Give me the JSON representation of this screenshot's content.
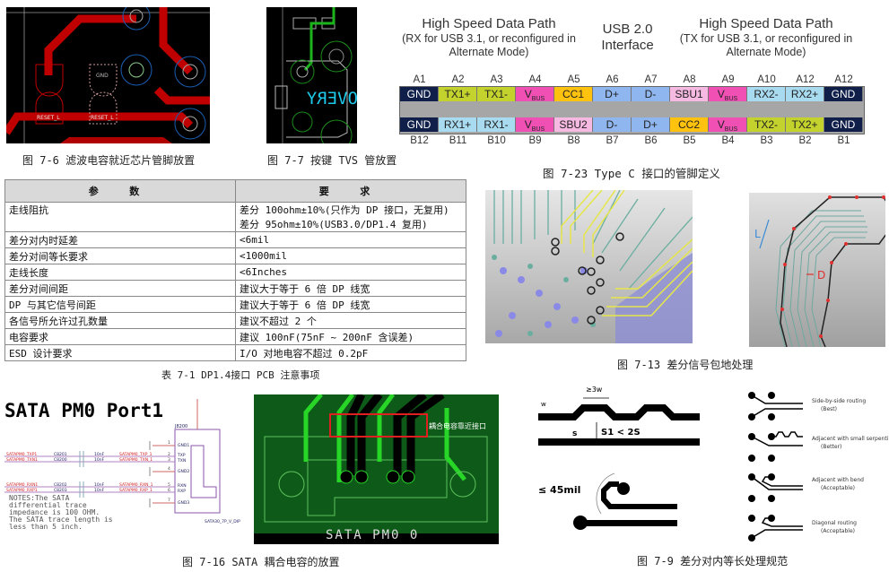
{
  "fig_7_6": {
    "caption": "图 7-6 滤波电容就近芯片管脚放置",
    "pcb_labels": [
      "GND",
      "RESET_L",
      "RESET_L"
    ]
  },
  "fig_7_7": {
    "caption": "图 7-7 按键 TVS 管放置",
    "silkscreen": "OVERY"
  },
  "usb_c": {
    "groups": [
      {
        "title": "High Speed Data Path",
        "sub": "(RX for USB 3.1, or reconfigured in Alternate Mode)",
        "color": "#a9dbf0"
      },
      {
        "title": "USB 2.0 Interface",
        "sub": "",
        "color": "#8fb6ee"
      },
      {
        "title": "High Speed Data Path",
        "sub": "(TX for USB 3.1, or reconfigured in Alternate Mode)",
        "color": "#c3d22c"
      }
    ],
    "row_a_labels": [
      "A1",
      "A2",
      "A3",
      "A4",
      "A5",
      "A6",
      "A7",
      "A8",
      "A9",
      "A10",
      "A12",
      "A12"
    ],
    "row_a_pins": [
      {
        "name": "GND",
        "sub": "",
        "color": "#0f1f4a",
        "text": "#ffffff"
      },
      {
        "name": "TX1+",
        "sub": "",
        "color": "#c3d22c",
        "text": "#222"
      },
      {
        "name": "TX1-",
        "sub": "",
        "color": "#c3d22c",
        "text": "#222"
      },
      {
        "name": "V",
        "sub": "BUS",
        "color": "#f050b4",
        "text": "#222"
      },
      {
        "name": "CC1",
        "sub": "",
        "color": "#ffc20e",
        "text": "#222"
      },
      {
        "name": "D+",
        "sub": "",
        "color": "#8fb6ee",
        "text": "#222"
      },
      {
        "name": "D-",
        "sub": "",
        "color": "#8fb6ee",
        "text": "#222"
      },
      {
        "name": "SBU1",
        "sub": "",
        "color": "#f6b9e2",
        "text": "#222"
      },
      {
        "name": "V",
        "sub": "BUS",
        "color": "#f050b4",
        "text": "#222"
      },
      {
        "name": "RX2-",
        "sub": "",
        "color": "#a9dbf0",
        "text": "#222"
      },
      {
        "name": "RX2+",
        "sub": "",
        "color": "#a9dbf0",
        "text": "#222"
      },
      {
        "name": "GND",
        "sub": "",
        "color": "#0f1f4a",
        "text": "#ffffff"
      }
    ],
    "row_b_pins": [
      {
        "name": "GND",
        "sub": "",
        "color": "#0f1f4a",
        "text": "#ffffff"
      },
      {
        "name": "RX1+",
        "sub": "",
        "color": "#a9dbf0",
        "text": "#222"
      },
      {
        "name": "RX1-",
        "sub": "",
        "color": "#a9dbf0",
        "text": "#222"
      },
      {
        "name": "V",
        "sub": "BUS",
        "color": "#f050b4",
        "text": "#222"
      },
      {
        "name": "SBU2",
        "sub": "",
        "color": "#f6b9e2",
        "text": "#222"
      },
      {
        "name": "D-",
        "sub": "",
        "color": "#8fb6ee",
        "text": "#222"
      },
      {
        "name": "D+",
        "sub": "",
        "color": "#8fb6ee",
        "text": "#222"
      },
      {
        "name": "CC2",
        "sub": "",
        "color": "#ffc20e",
        "text": "#222"
      },
      {
        "name": "V",
        "sub": "BUS",
        "color": "#f050b4",
        "text": "#222"
      },
      {
        "name": "TX2-",
        "sub": "",
        "color": "#c3d22c",
        "text": "#222"
      },
      {
        "name": "TX2+",
        "sub": "",
        "color": "#c3d22c",
        "text": "#222"
      },
      {
        "name": "GND",
        "sub": "",
        "color": "#0f1f4a",
        "text": "#ffffff"
      }
    ],
    "row_b_labels": [
      "B12",
      "B11",
      "B10",
      "B9",
      "B8",
      "B7",
      "B6",
      "B5",
      "B4",
      "B3",
      "B2",
      "B1"
    ],
    "caption": "图 7-23 Type C 接口的管脚定义"
  },
  "table": {
    "headers": [
      "参 数",
      "要 求"
    ],
    "rows": [
      [
        "走线阻抗",
        "差分 100ohm±10%(只作为 DP 接口，无复用)\n差分 95ohm±10%(USB3.0/DP1.4 复用)"
      ],
      [
        "差分对内时延差",
        "<6mil"
      ],
      [
        "差分对间等长要求",
        "<1000mil"
      ],
      [
        "走线长度",
        "<6Inches"
      ],
      [
        "差分对间间距",
        "建议大于等于 6 倍 DP 线宽"
      ],
      [
        "DP 与其它信号间距",
        "建议大于等于 6 倍 DP 线宽"
      ],
      [
        "各信号所允许过孔数量",
        "建议不超过 2 个"
      ],
      [
        "电容要求",
        "建议 100nF(75nF ~ 200nF 含误差)"
      ],
      [
        "ESD 设计要求",
        "I/O 对地电容不超过 0.2pF"
      ]
    ],
    "caption": "表 7-1 DP1.4接口 PCB 注意事项"
  },
  "fig_7_13": {
    "caption": "图 7-13 差分信号包地处理",
    "label_l": "L",
    "label_d": "D"
  },
  "fig_7_16": {
    "schematic_title": "SATA PM0 Port1",
    "ref": "J8200",
    "part": "SATA30_7P_V_DIP",
    "nets": [
      {
        "left": "SATAPM0_TXP1",
        "cap": "C8201",
        "val": "10nF",
        "right": "SATAPM0_TXP_1",
        "pin": "2",
        "port": "TXP"
      },
      {
        "left": "SATAPM0_TXN1",
        "cap": "C8200",
        "val": "10nF",
        "right": "SATAPM0_TXN_1",
        "pin": "3",
        "port": "TXN"
      },
      {
        "left": "SATAPM0_RXN1",
        "cap": "C8202",
        "val": "10nF",
        "right": "SATAPM0_RXN_1",
        "pin": "5",
        "port": "RXN"
      },
      {
        "left": "SATAPM0_RXP1",
        "cap": "C8203",
        "val": "10nF",
        "right": "SATAPM0_RXP_1",
        "pin": "6",
        "port": "RXP"
      }
    ],
    "gnd_pins": [
      {
        "pin": "1",
        "port": "GND1"
      },
      {
        "pin": "4",
        "port": "GND2"
      },
      {
        "pin": "7",
        "port": "GND3"
      }
    ],
    "notes": [
      "NOTES:The SATA",
      "differential trace",
      "impedance is 100 OHM.",
      "The SATA trace length is",
      "less than 5 inch."
    ],
    "pcb_annotation": "耦合电容靠近接口",
    "pcb_silkscreen": "SATA PM0 0",
    "caption": "图 7-16  SATA 耦合电容的放置"
  },
  "fig_7_9": {
    "label_3w": "≥3w",
    "label_w": "w",
    "label_s": "s",
    "label_s1": "S1 < 2S",
    "label_45": "≤ 45mil",
    "routing": [
      {
        "title": "Side-by-side routing",
        "rating": "(Best)"
      },
      {
        "title": "Adjacent with small serpentine",
        "rating": "(Better)"
      },
      {
        "title": "Adjacent with bend",
        "rating": "(Acceptable)"
      },
      {
        "title": "Diagonal routing",
        "rating": "(Acceptable)"
      }
    ],
    "caption": "图 7-9 差分对内等长处理规范"
  }
}
